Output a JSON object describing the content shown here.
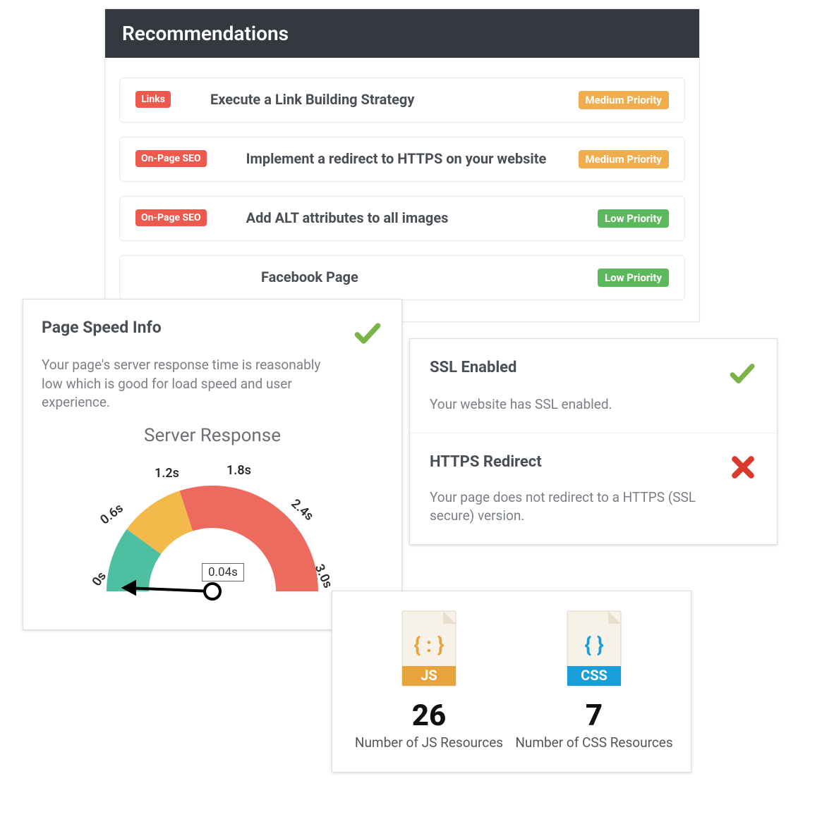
{
  "recommendations": {
    "header": "Recommendations",
    "items": [
      {
        "category": "Links",
        "title": "Execute a Link Building Strategy",
        "priority": "Medium Priority",
        "priority_level": "medium"
      },
      {
        "category": "On-Page SEO",
        "title": "Implement a redirect to HTTPS on your website",
        "priority": "Medium Priority",
        "priority_level": "medium"
      },
      {
        "category": "On-Page SEO",
        "title": "Add ALT attributes to all images",
        "priority": "Low Priority",
        "priority_level": "low"
      },
      {
        "category": "",
        "title": "Facebook Page",
        "priority": "Low Priority",
        "priority_level": "low"
      }
    ]
  },
  "page_speed": {
    "title": "Page Speed Info",
    "description": "Your page's server response time is reasonably low which is good for load speed and user experience.",
    "status": "ok",
    "gauge": {
      "title": "Server Response",
      "ticks": [
        "0s",
        "0.6s",
        "1.2s",
        "1.8s",
        "2.4s",
        "3.0s"
      ],
      "value_label": "0.04s",
      "value_seconds": 0.04,
      "max_seconds": 3.0
    }
  },
  "ssl": {
    "enabled": {
      "title": "SSL Enabled",
      "description": "Your website has SSL enabled.",
      "status": "ok"
    },
    "redirect": {
      "title": "HTTPS Redirect",
      "description": "Your page does not redirect to a HTTPS (SSL secure) version.",
      "status": "fail"
    }
  },
  "resources": {
    "js": {
      "count": "26",
      "label": "Number of JS Resources",
      "badge": "JS"
    },
    "css": {
      "count": "7",
      "label": "Number of CSS Resources",
      "badge": "CSS"
    }
  },
  "colors": {
    "ok": "#7bb446",
    "fail": "#d93a2b",
    "accent_orange": "#e7a43c",
    "accent_blue": "#1a9ed9",
    "gauge_green": "#4fbfa1",
    "gauge_yellow": "#f3b94a",
    "gauge_red": "#ed6a5e"
  }
}
